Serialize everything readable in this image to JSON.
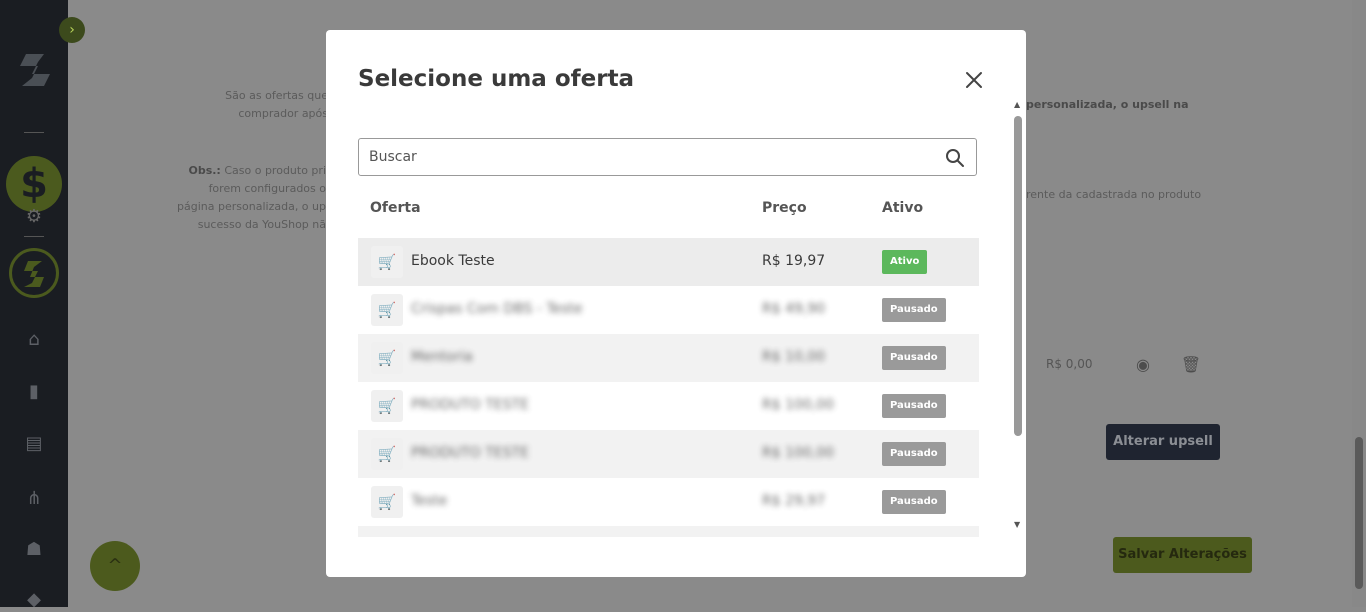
{
  "background": {
    "description_text": [
      "São as ofertas que",
      "comprador após"
    ],
    "description_text_right": "personalizada, o upsell na",
    "obs_label": "Obs.:",
    "obs_lines": [
      "Caso o produto pri",
      "forem configurados o",
      "página personalizada, o up",
      "sucesso da YouShop nã"
    ],
    "obs_right": "rente da cadastrada no produto",
    "upsell_price": "R$ 0,00",
    "alterar_upsell_label": "Alterar upsell",
    "salvar_label": "Salvar Alterações"
  },
  "modal": {
    "title": "Selecione uma oferta",
    "search_placeholder": "Buscar",
    "columns": {
      "offer": "Oferta",
      "price": "Preço",
      "active": "Ativo"
    },
    "rows": [
      {
        "name": "Ebook Teste",
        "price": "R$ 19,97",
        "status": "Ativo"
      },
      {
        "name": "Crispas Com DBS - Teste",
        "price": "R$ 49,90",
        "status": "Pausado"
      },
      {
        "name": "Mentoria",
        "price": "R$ 10,00",
        "status": "Pausado"
      },
      {
        "name": "PRODUTO TESTE",
        "price": "R$ 100,00",
        "status": "Pausado"
      },
      {
        "name": "PRODUTO TESTE",
        "price": "R$ 100,00",
        "status": "Pausado"
      },
      {
        "name": "Teste",
        "price": "R$ 29,97",
        "status": "Pausado"
      }
    ]
  },
  "colors": {
    "active_badge": "#5cb85c",
    "paused_badge": "#9a9a9a",
    "brand_green": "#8cb43a"
  }
}
